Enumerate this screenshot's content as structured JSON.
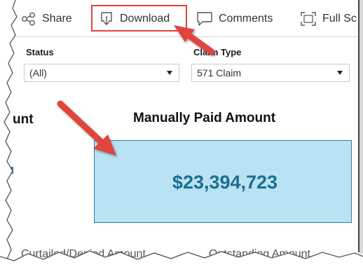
{
  "toolbar": {
    "share_label": "Share",
    "download_label": "Download",
    "comments_label": "Comments",
    "fullscreen_label": "Full Sc"
  },
  "filters": {
    "status": {
      "label": "Status",
      "value": "(All)"
    },
    "claim_type": {
      "label": "Claim Type",
      "value": "571 Claim"
    }
  },
  "kpi": {
    "left_heading_fragment": "unt",
    "heading": "Manually Paid Amount",
    "value": "$23,394,723"
  },
  "bottom": {
    "left_label": "Curtailed/Denied Amount",
    "right_label": "Outstanding Amount"
  },
  "colors": {
    "highlight_red": "#e0443c",
    "arrow_red": "#e0443c",
    "kpi_fill": "#b9e2f2",
    "kpi_text": "#1c6e91"
  },
  "icons": {
    "share": "share-icon",
    "download": "download-icon",
    "comments": "comment-icon",
    "fullscreen": "fullscreen-icon"
  }
}
